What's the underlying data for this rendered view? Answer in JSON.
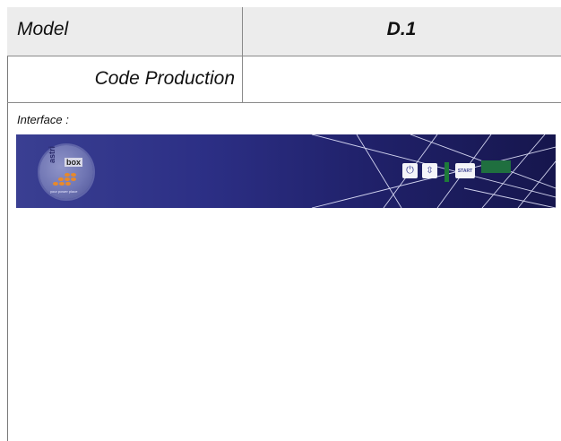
{
  "table": {
    "model_label": "Model",
    "model_value": "D.1",
    "code_production_label": "Code Production",
    "code_production_value": ""
  },
  "interface": {
    "label": "Interface :",
    "logo": {
      "word": "box",
      "side_word": "astri",
      "tagline": "your power place"
    },
    "controls": {
      "power_icon": "power-icon",
      "updown_icon": "up-down-arrows-icon",
      "start_label": "START"
    }
  },
  "colors": {
    "banner_left": "#3a3f92",
    "banner_right": "#16164d",
    "green_indicator": "#1e7a3a",
    "header_row_bg": "#ececec",
    "logo_dots": "#e8892a"
  }
}
